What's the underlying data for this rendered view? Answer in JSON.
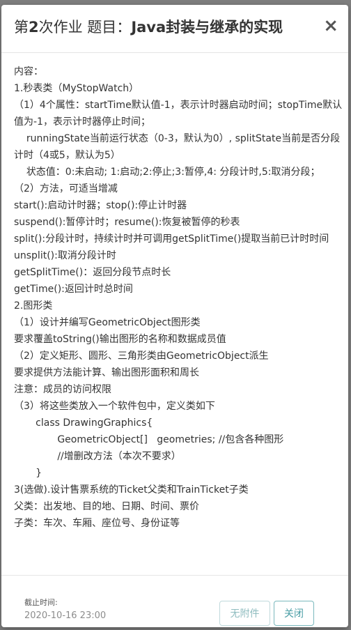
{
  "modal": {
    "title_prefix": "第",
    "title_number": "2",
    "title_mid": "次作业 题目：",
    "title_bold": "Java封装与继承的实现",
    "close_glyph": "×"
  },
  "body": {
    "lines": [
      "内容：",
      "1.秒表类（MyStopWatch）",
      "（1）4个属性：startTime默认值-1，表示计时器启动时间；stopTime默认值为-1，表示计时器停止时间；",
      "    runningState当前运行状态（0-3，默认为0）, splitState当前是否分段计时（4或5，默认为5）",
      "    状态值：0:未启动; 1:启动;2:停止;3:暂停,4: 分段计时,5:取消分段；",
      "（2）方法，可适当增减",
      "start():启动计时器；stop():停止计时器",
      "suspend():暂停计时；resume():恢复被暂停的秒表",
      "split():分段计时，持续计时并可调用getSplitTime()提取当前已计时时间",
      "unsplit():取消分段计时",
      "getSplitTime()：返回分段节点时长",
      "getTime():返回计时总时间",
      "2.图形类",
      "（1）设计并编写GeometricObject图形类",
      "要求覆盖toString()输出图形的名称和数据成员值",
      "（2）定义矩形、圆形、三角形类由GeometricObject派生",
      "要求提供方法能计算、输出图形面积和周长",
      "注意：成员的访问权限",
      "（3）将这些类放入一个软件包中，定义类如下",
      "       class DrawingGraphics{",
      "              GeometricObject[]   geometries; //包含各种图形",
      "              //增删改方法（本次不要求）",
      "       }",
      "3(选做).设计售票系统的Ticket父类和TrainTicket子类",
      "父类：出发地、目的地、日期、时间、票价",
      "子类：车次、车厢、座位号、身份证等"
    ]
  },
  "footer": {
    "deadline_label": "截止时间:",
    "deadline_value": "2020-10-16 23:00",
    "no_attachment_label": "无附件",
    "close_label": "关闭"
  },
  "colors": {
    "overlay": "#7f7f7f",
    "accent": "#4a9ea5",
    "accent_light": "#8fbcbf"
  }
}
